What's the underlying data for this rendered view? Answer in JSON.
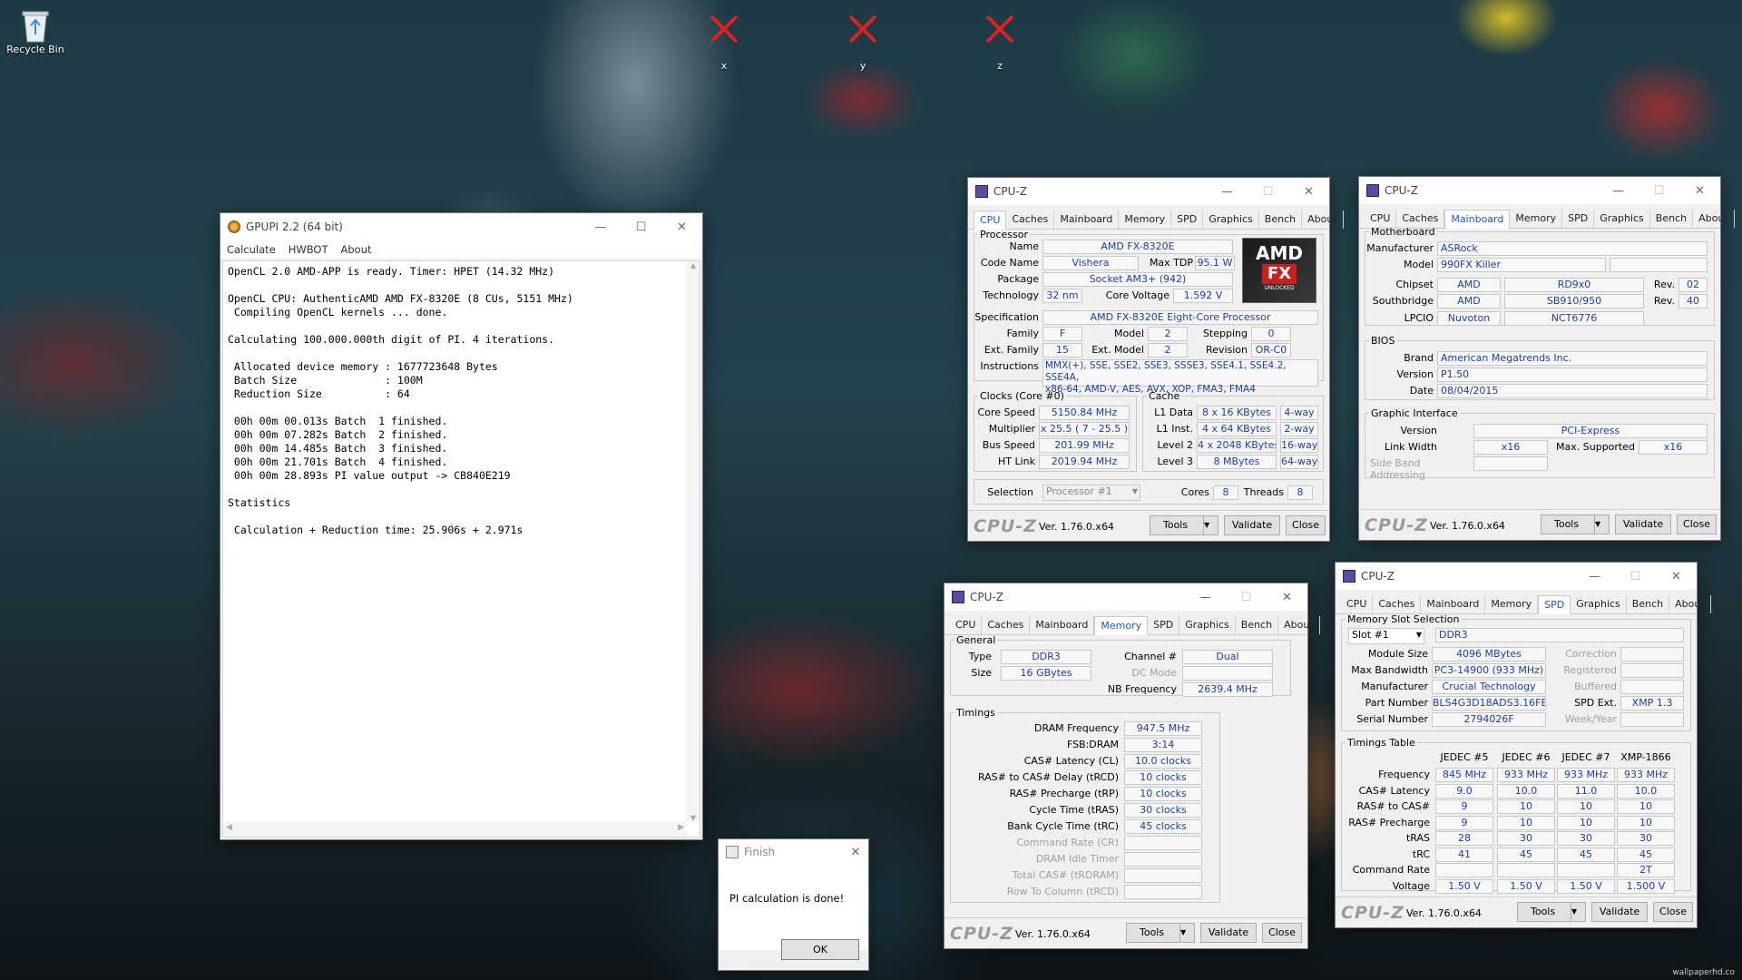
{
  "desktop": {
    "recycle_bin": "Recycle Bin",
    "markers": [
      "x",
      "y",
      "z"
    ],
    "watermark": "wallpaperhd.co"
  },
  "gpupi": {
    "title": "GPUPI 2.2 (64 bit)",
    "menu": [
      "Calculate",
      "HWBOT",
      "About"
    ],
    "lines": [
      "OpenCL 2.0 AMD-APP is ready. Timer: HPET (14.32 MHz)",
      "",
      "OpenCL CPU: AuthenticAMD AMD FX-8320E (8 CUs, 5151 MHz)",
      " Compiling OpenCL kernels ... done.",
      "",
      "Calculating 100.000.000th digit of PI. 4 iterations.",
      "",
      " Allocated device memory : 1677723648 Bytes",
      " Batch Size              : 100M",
      " Reduction Size          : 64",
      "",
      " 00h 00m 00.013s Batch  1 finished.",
      " 00h 00m 07.282s Batch  2 finished.",
      " 00h 00m 14.485s Batch  3 finished.",
      " 00h 00m 21.701s Batch  4 finished.",
      " 00h 00m 28.893s PI value output -> CB840E219",
      "",
      "Statistics",
      "",
      " Calculation + Reduction time: 25.906s + 2.971s"
    ]
  },
  "finish": {
    "title": "Finish",
    "message": "PI calculation is done!",
    "ok": "OK"
  },
  "cpuz_common": {
    "title": "CPU-Z",
    "tabs": [
      "CPU",
      "Caches",
      "Mainboard",
      "Memory",
      "SPD",
      "Graphics",
      "Bench",
      "About"
    ],
    "logo": "CPU-Z",
    "version": "Ver. 1.76.0.x64",
    "tools": "Tools",
    "validate": "Validate",
    "close": "Close"
  },
  "cpu_tab": {
    "processor_legend": "Processor",
    "name_label": "Name",
    "name": "AMD FX-8320E",
    "codename_label": "Code Name",
    "codename": "Vishera",
    "maxtdp_label": "Max TDP",
    "maxtdp": "95.1 W",
    "package_label": "Package",
    "package": "Socket AM3+ (942)",
    "technology_label": "Technology",
    "technology": "32 nm",
    "corevoltage_label": "Core Voltage",
    "corevoltage": "1.592 V",
    "spec_label": "Specification",
    "spec": "AMD FX-8320E Eight-Core Processor",
    "family_label": "Family",
    "family": "F",
    "model_label": "Model",
    "model": "2",
    "stepping_label": "Stepping",
    "stepping": "0",
    "extfamily_label": "Ext. Family",
    "extfamily": "15",
    "extmodel_label": "Ext. Model",
    "extmodel": "2",
    "revision_label": "Revision",
    "revision": "OR-C0",
    "instr_label": "Instructions",
    "instr_line1": "MMX(+), SSE, SSE2, SSE3, SSSE3, SSE4.1, SSE4.2, SSE4A,",
    "instr_line2": "x86-64, AMD-V, AES, AVX, XOP, FMA3, FMA4",
    "clocks_legend": "Clocks (Core #0)",
    "corespeed_label": "Core Speed",
    "corespeed": "5150.84 MHz",
    "multiplier_label": "Multiplier",
    "multiplier": "x 25.5 ( 7 - 25.5 )",
    "busspeed_label": "Bus Speed",
    "busspeed": "201.99 MHz",
    "htlink_label": "HT Link",
    "htlink": "2019.94 MHz",
    "cache_legend": "Cache",
    "l1d_label": "L1 Data",
    "l1d": "8 x 16 KBytes",
    "l1d_way": "4-way",
    "l1i_label": "L1 Inst.",
    "l1i": "4 x 64 KBytes",
    "l1i_way": "2-way",
    "l2_label": "Level 2",
    "l2": "4 x 2048 KBytes",
    "l2_way": "16-way",
    "l3_label": "Level 3",
    "l3": "8 MBytes",
    "l3_way": "64-way",
    "selection_label": "Selection",
    "selection": "Processor #1",
    "cores_label": "Cores",
    "cores": "8",
    "threads_label": "Threads",
    "threads": "8",
    "amd_logo_top": "AMD",
    "amd_logo_fx": "FX",
    "amd_logo_sub": "UNLOCKED"
  },
  "mainboard_tab": {
    "mb_legend": "Motherboard",
    "manufacturer_label": "Manufacturer",
    "manufacturer": "ASRock",
    "model_label": "Model",
    "model": "990FX Killer",
    "chipset_label": "Chipset",
    "chipset_vendor": "AMD",
    "chipset": "RD9x0",
    "chipset_rev_label": "Rev.",
    "chipset_rev": "02",
    "southbridge_label": "Southbridge",
    "sb_vendor": "AMD",
    "sb": "SB910/950",
    "sb_rev_label": "Rev.",
    "sb_rev": "40",
    "lpcio_label": "LPCIO",
    "lpcio_vendor": "Nuvoton",
    "lpcio": "NCT6776",
    "bios_legend": "BIOS",
    "brand_label": "Brand",
    "brand": "American Megatrends Inc.",
    "version_label": "Version",
    "version": "P1.50",
    "date_label": "Date",
    "date": "08/04/2015",
    "gi_legend": "Graphic Interface",
    "gi_version_label": "Version",
    "gi_version": "PCI-Express",
    "linkwidth_label": "Link Width",
    "linkwidth": "x16",
    "maxsupported_label": "Max. Supported",
    "maxsupported": "x16",
    "sideband_label": "Side Band Addressing"
  },
  "memory_tab": {
    "general_legend": "General",
    "type_label": "Type",
    "type": "DDR3",
    "channel_label": "Channel #",
    "channel": "Dual",
    "size_label": "Size",
    "size": "16 GBytes",
    "dcmode_label": "DC Mode",
    "nbfreq_label": "NB Frequency",
    "nbfreq": "2639.4 MHz",
    "timings_legend": "Timings",
    "rows": [
      {
        "label": "DRAM Frequency",
        "value": "947.5 MHz",
        "dim": false
      },
      {
        "label": "FSB:DRAM",
        "value": "3:14",
        "dim": false
      },
      {
        "label": "CAS# Latency (CL)",
        "value": "10.0 clocks",
        "dim": false
      },
      {
        "label": "RAS# to CAS# Delay (tRCD)",
        "value": "10 clocks",
        "dim": false
      },
      {
        "label": "RAS# Precharge (tRP)",
        "value": "10 clocks",
        "dim": false
      },
      {
        "label": "Cycle Time (tRAS)",
        "value": "30 clocks",
        "dim": false
      },
      {
        "label": "Bank Cycle Time (tRC)",
        "value": "45 clocks",
        "dim": false
      },
      {
        "label": "Command Rate (CR)",
        "value": "",
        "dim": true
      },
      {
        "label": "DRAM Idle Timer",
        "value": "",
        "dim": true
      },
      {
        "label": "Total CAS# (tRDRAM)",
        "value": "",
        "dim": true
      },
      {
        "label": "Row To Column (tRCD)",
        "value": "",
        "dim": true
      }
    ]
  },
  "spd_tab": {
    "slot_legend": "Memory Slot Selection",
    "slot": "Slot #1",
    "slot_type": "DDR3",
    "modulesize_label": "Module Size",
    "modulesize": "4096 MBytes",
    "correction_label": "Correction",
    "maxbw_label": "Max Bandwidth",
    "maxbw": "PC3-14900 (933 MHz)",
    "registered_label": "Registered",
    "manufacturer_label": "Manufacturer",
    "manufacturer": "Crucial Technology",
    "buffered_label": "Buffered",
    "partnumber_label": "Part Number",
    "partnumber": "BLS4G3D18ADS3.16FE",
    "spdext_label": "SPD Ext.",
    "spdext": "XMP 1.3",
    "serial_label": "Serial Number",
    "serial": "2794026F",
    "weekyear_label": "Week/Year",
    "timings_legend": "Timings Table",
    "columns": [
      "JEDEC #5",
      "JEDEC #6",
      "JEDEC #7",
      "XMP-1866"
    ],
    "rows": [
      {
        "label": "Frequency",
        "values": [
          "845 MHz",
          "933 MHz",
          "933 MHz",
          "933 MHz"
        ]
      },
      {
        "label": "CAS# Latency",
        "values": [
          "9.0",
          "10.0",
          "11.0",
          "10.0"
        ]
      },
      {
        "label": "RAS# to CAS#",
        "values": [
          "9",
          "10",
          "10",
          "10"
        ]
      },
      {
        "label": "RAS# Precharge",
        "values": [
          "9",
          "10",
          "10",
          "10"
        ]
      },
      {
        "label": "tRAS",
        "values": [
          "28",
          "30",
          "30",
          "30"
        ]
      },
      {
        "label": "tRC",
        "values": [
          "41",
          "45",
          "45",
          "45"
        ]
      },
      {
        "label": "Command Rate",
        "values": [
          "",
          "",
          "",
          "2T"
        ]
      },
      {
        "label": "Voltage",
        "values": [
          "1.50 V",
          "1.50 V",
          "1.50 V",
          "1.500 V"
        ]
      }
    ]
  }
}
